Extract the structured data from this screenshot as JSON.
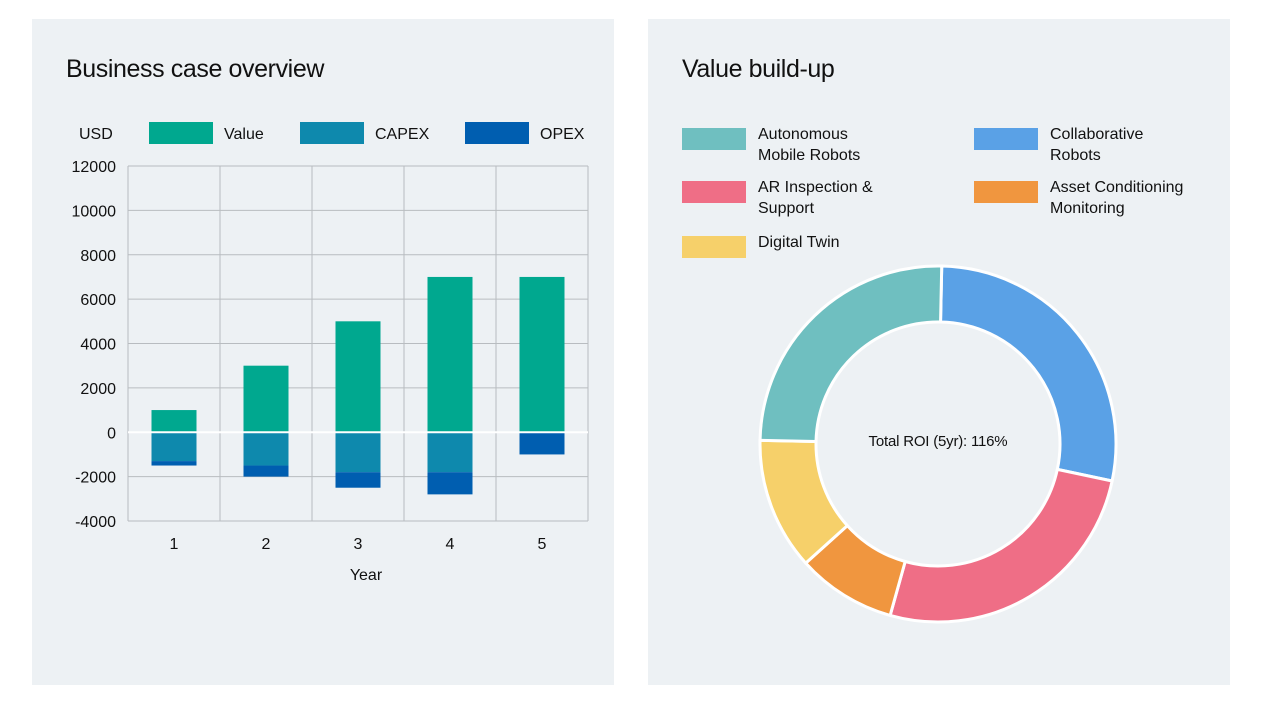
{
  "left_panel": {
    "title": "Business case overview"
  },
  "right_panel": {
    "title": "Value build-up",
    "center_label": "Total ROI (5yr): 116%"
  },
  "chart_data": [
    {
      "type": "bar",
      "stacked": true,
      "title": "Business case overview",
      "xlabel": "Year",
      "ylabel": "USD",
      "categories": [
        "1",
        "2",
        "3",
        "4",
        "5"
      ],
      "ylim": [
        -4000,
        12000
      ],
      "yticks": [
        12000,
        10000,
        8000,
        6000,
        4000,
        2000,
        0,
        -2000,
        -4000
      ],
      "grid": true,
      "legend_position": "top",
      "series": [
        {
          "name": "Value",
          "color": "#00a88f",
          "values": [
            1000,
            3000,
            5000,
            7000,
            7000
          ]
        },
        {
          "name": "CAPEX",
          "color": "#0e89ad",
          "values": [
            -1300,
            -1500,
            -1800,
            -1800,
            0
          ]
        },
        {
          "name": "OPEX",
          "color": "#005eb0",
          "values": [
            -200,
            -500,
            -700,
            -1000,
            -1000
          ]
        }
      ]
    },
    {
      "type": "pie",
      "donut": true,
      "title": "Value build-up",
      "center_label": "Total ROI (5yr): 116%",
      "legend_position": "top",
      "slices": [
        {
          "label": "Autonomous Mobile Robots",
          "color": "#6fbfc0",
          "value": 25
        },
        {
          "label": "Collaborative Robots",
          "color": "#5aa1e6",
          "value": 28
        },
        {
          "label": "AR Inspection & Support",
          "color": "#ef6e86",
          "value": 26
        },
        {
          "label": "Asset Conditioning Monitoring",
          "color": "#f0963f",
          "value": 9
        },
        {
          "label": "Digital Twin",
          "color": "#f6d06a",
          "value": 12
        }
      ]
    }
  ]
}
